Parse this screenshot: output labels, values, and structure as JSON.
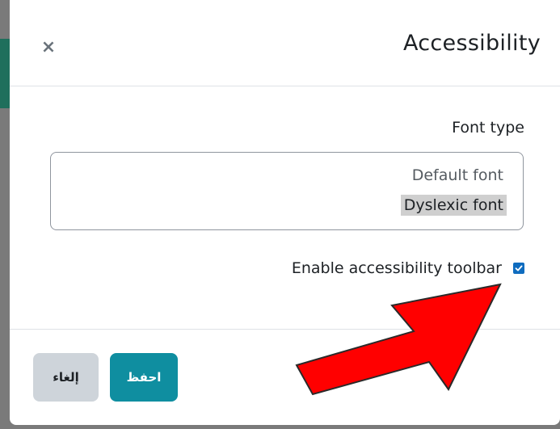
{
  "modal": {
    "title": "Accessibility",
    "close_label": "×"
  },
  "font": {
    "label": "Font type",
    "options": [
      "Default font",
      "Dyslexic font"
    ],
    "selected": "Dyslexic font"
  },
  "toolbar": {
    "label": "Enable accessibility toolbar",
    "checked": true
  },
  "footer": {
    "save_label": "احفظ",
    "cancel_label": "إلغاء"
  },
  "colors": {
    "save_button": "#0f8ea0",
    "cancel_button": "#ced4da",
    "checkbox": "#0f6cbf",
    "arrow": "#ff0000"
  },
  "icons": {
    "close": "close-icon",
    "checkbox": "checkmark-icon"
  }
}
